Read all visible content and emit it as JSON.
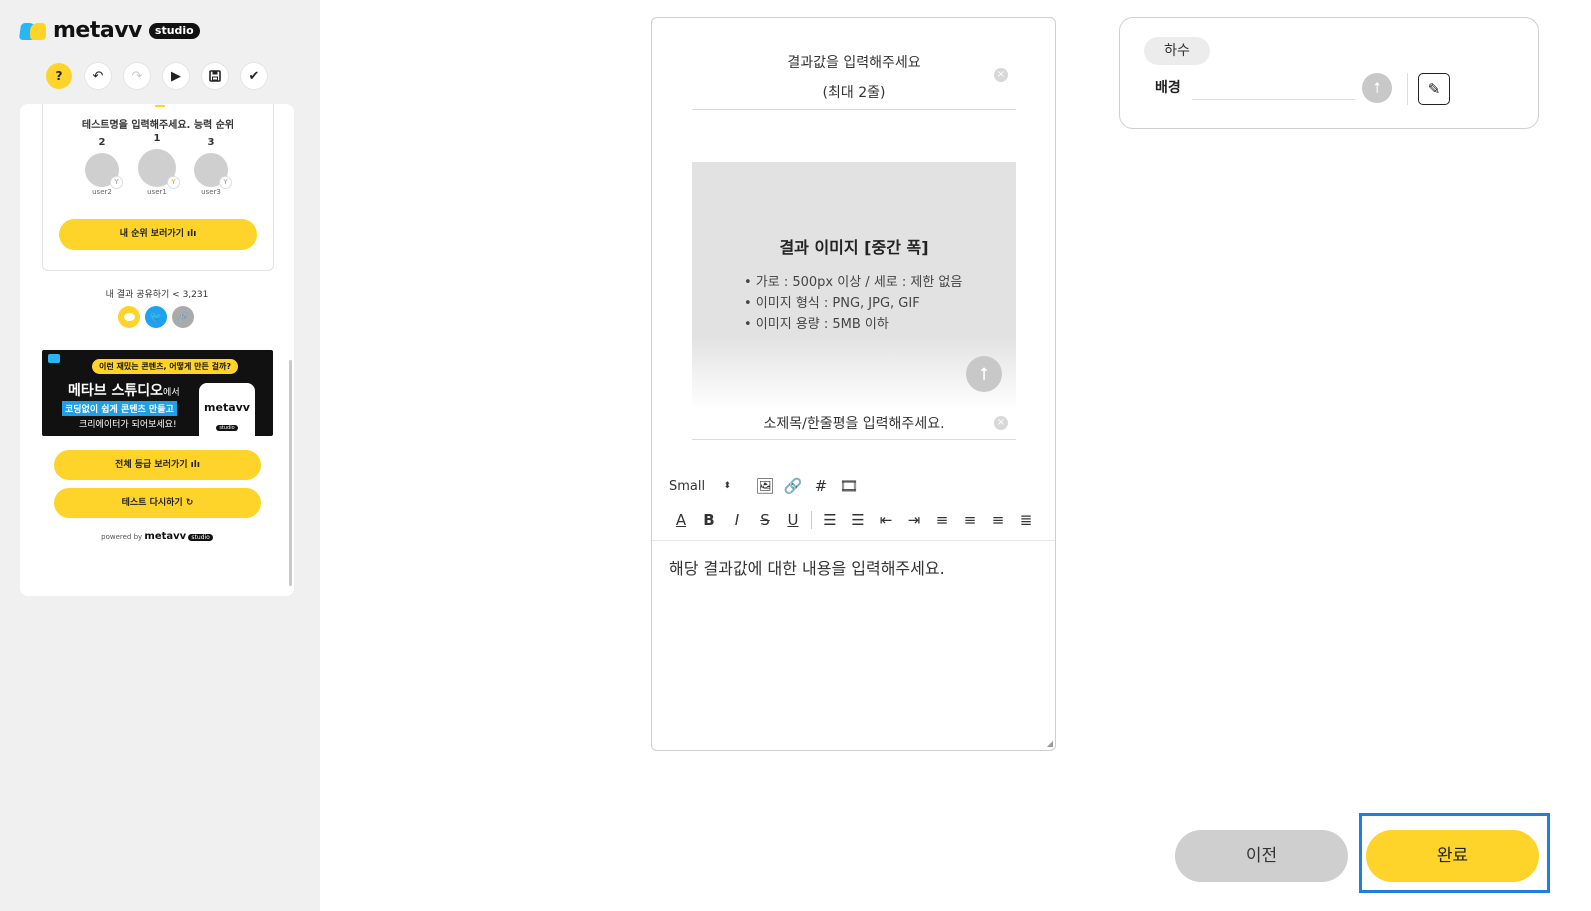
{
  "app": {
    "logo_text": "metavv",
    "logo_badge": "studio"
  },
  "toolbar": {
    "help": "?",
    "undo_icon": "undo-icon",
    "redo_icon": "redo-icon",
    "play_icon": "play-icon",
    "save_icon": "save-icon",
    "check_icon": "check-icon"
  },
  "preview": {
    "rank_title": "테스트명을 입력해주세요. 능력 순위",
    "ranks": [
      {
        "num": "2",
        "user": "user2"
      },
      {
        "num": "1",
        "user": "user1"
      },
      {
        "num": "3",
        "user": "user3"
      }
    ],
    "my_rank_button": "내 순위 보러가기 ılı",
    "share_text": "내 결과 공유하기 < 3,231",
    "banner": {
      "bubble": "이런 재밌는 콘텐츠, 어떻게 만든 걸까?",
      "line1": "메타브 스튜디오",
      "line1_suffix": "에서",
      "line2": "코딩없이 쉽게 콘텐츠 만들고",
      "line3": "크리에이터가 되어보세요!",
      "phone_logo": "metavv",
      "phone_badge": "studio"
    },
    "all_rank_button": "전체 등급 보러가기 ılı",
    "retry_button": "테스트 다시하기 ↻",
    "powered_prefix": "powered by",
    "powered_logo": "metavv",
    "powered_badge": "studio"
  },
  "editor": {
    "result_line1": "결과값을 입력해주세요",
    "result_line2": "(최대 2줄)",
    "image_title": "결과 이미지 [중간 폭]",
    "image_bullets": [
      "• 가로 : 500px 이상 / 세로 : 제한 없음",
      "• 이미지 형식 : PNG, JPG, GIF",
      "• 이미지 용량 : 5MB 이하"
    ],
    "subtitle_placeholder": "소제목/한줄평을 입력해주세요.",
    "font_size": "Small",
    "content_text": "해당 결과값에 대한 내용을 입력해주세요."
  },
  "background_card": {
    "chip": "하수",
    "label": "배경"
  },
  "buttons": {
    "prev": "이전",
    "done": "완료"
  },
  "colors": {
    "accent": "#ffd42a",
    "highlight": "#1e7fe0",
    "disabled": "#cfcfcf"
  }
}
